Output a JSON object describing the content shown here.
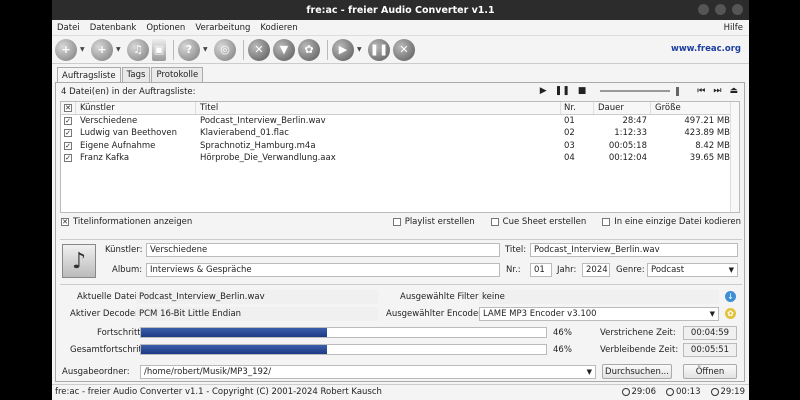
{
  "window": {
    "title": "fre:ac - freier Audio Converter v1.1"
  },
  "menu": [
    "Datei",
    "Datenbank",
    "Optionen",
    "Verarbeitung",
    "Kodieren"
  ],
  "menu_help": "Hilfe",
  "toolbar": {
    "link": "www.freac.org"
  },
  "tabs": [
    "Auftragsliste",
    "Tags",
    "Protokolle"
  ],
  "joblist": {
    "count_label": "4 Datei(en) in der Auftragsliste:",
    "columns": [
      "Künstler",
      "Titel",
      "Nr.",
      "Dauer",
      "Größe"
    ],
    "rows": [
      {
        "artist": "Verschiedene",
        "title": "Podcast_Interview_Berlin.wav",
        "nr": "01",
        "duration": "28:47",
        "size": "497.21 MB"
      },
      {
        "artist": "Ludwig van Beethoven",
        "title": "Klavierabend_01.flac",
        "nr": "02",
        "duration": "1:12:33",
        "size": "423.89 MB"
      },
      {
        "artist": "Eigene Aufnahme",
        "title": "Sprachnotiz_Hamburg.m4a",
        "nr": "03",
        "duration": "00:05:18",
        "size": "8.42 MB"
      },
      {
        "artist": "Franz Kafka",
        "title": "Hörprobe_Die_Verwandlung.aax",
        "nr": "04",
        "duration": "00:12:04",
        "size": "39.65 MB"
      }
    ]
  },
  "options": {
    "show_title_info": "Titelinformationen anzeigen",
    "playlist": "Playlist erstellen",
    "cuesheet": "Cue Sheet erstellen",
    "single_file": "In eine einzige Datei kodieren"
  },
  "tags": {
    "artist_label": "Künstler:",
    "artist": "Verschiedene",
    "title_label": "Titel:",
    "title": "Podcast_Interview_Berlin.wav",
    "album_label": "Album:",
    "album": "Interviews & Gespräche",
    "nr_label": "Nr.:",
    "nr": "01",
    "year_label": "Jahr:",
    "year": "2024",
    "genre_label": "Genre:",
    "genre": "Podcast"
  },
  "status": {
    "current_file_label": "Aktuelle Datei:",
    "current_file": "Podcast_Interview_Berlin.wav",
    "filter_label": "Ausgewählte Filter:",
    "filter": "keine",
    "decoder_label": "Aktiver Decoder:",
    "decoder": "PCM 16-Bit Little Endian",
    "encoder_label": "Ausgewählter Encoder:",
    "encoder": "LAME MP3 Encoder v3.100",
    "progress_label": "Fortschritt:",
    "progress": 0.46,
    "progress_text": "46%",
    "total_label": "Gesamtfortschritt:",
    "total": 0.46,
    "total_text": "46%",
    "elapsed_label": "Verstrichene Zeit:",
    "elapsed": "00:04:59",
    "remaining_label": "Verbleibende Zeit:",
    "remaining": "00:05:51",
    "outdir_label": "Ausgabeordner:",
    "outdir": "/home/robert/Musik/MP3_192/",
    "browse": "Durchsuchen...",
    "open": "Öffnen"
  },
  "footer": {
    "text": "fre:ac - freier Audio Converter v1.1 - Copyright (C) 2001-2024 Robert Kausch",
    "t1": "29:06",
    "t2": "00:13",
    "t3": "29:19"
  }
}
